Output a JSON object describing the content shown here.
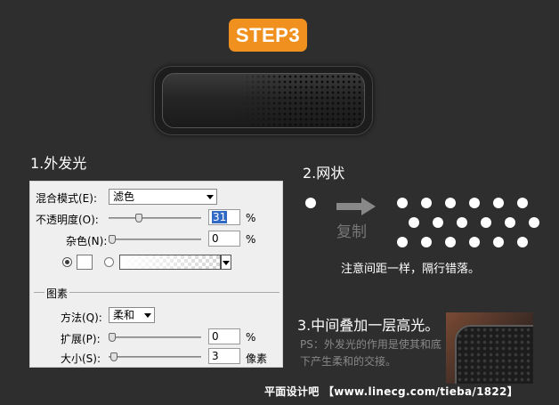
{
  "step_badge": "STEP3",
  "headings": {
    "outer_glow": "1.外发光",
    "grid": "2.网状",
    "overlay": "3.中间叠加一层高光。"
  },
  "panel": {
    "blend_mode_label": "混合模式(E):",
    "blend_mode_value": "滤色",
    "opacity_label": "不透明度(O):",
    "opacity_value": "31",
    "noise_label": "杂色(N):",
    "noise_value": "0",
    "percent": "%",
    "section_title": "图素",
    "method_label": "方法(Q):",
    "method_value": "柔和",
    "spread_label": "扩展(P):",
    "spread_value": "0",
    "size_label": "大小(S):",
    "size_value": "3",
    "size_unit": "像素",
    "opacity_level": 31,
    "noise_level": 0,
    "spread_level": 0,
    "size_level": 3
  },
  "grid_section": {
    "copy_label": "复制",
    "note": "注意间距一样，隔行错落。"
  },
  "ps_note": "PS：外发光的作用是使其和底下产生柔和的交接。",
  "footer": "平面设计吧 【www.linecg.com/tieba/1822】",
  "colors": {
    "accent": "#f0901e",
    "background": "#2e2e2e"
  }
}
